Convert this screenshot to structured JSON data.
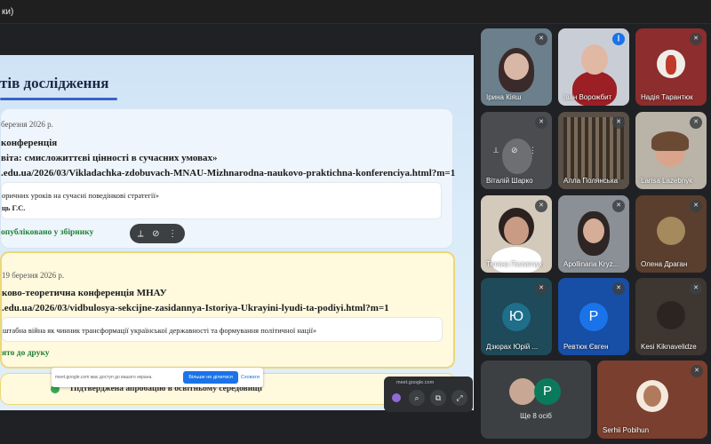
{
  "window": {
    "title": "ки)"
  },
  "screen": {
    "title": "тів дослідження",
    "cards": [
      {
        "date": "березня 2026 р.",
        "type": "конференція",
        "theme": "віта: смисложиттєві цінності в сучасних умовах»",
        "url": ".edu.ua/2026/03/Vikladachka-zdobuvach-MNAU-Mizhnarodna-naukovo-praktichna-konferenciya.html?m=1",
        "paper_title": "оричних уроків на сучасні поведінкові стратегії»",
        "authors": "ць Г.С.",
        "status": "опубліковано у збірнику"
      },
      {
        "date": "19 березня 2026 р.",
        "type": "ково-теоретична конференція МНАУ",
        "url": ".edu.ua/2026/03/vidbulosya-sekcijne-zasidannya-Istoriya-Ukrayini-lyudi-ta-podiyi.html?m=1",
        "paper_title": "штабна війна як чинник трансформації української державності та формування політичної нації»",
        "status": "ято до друку"
      },
      {
        "status": "Підтверджена апробацію в освітньому середовищі"
      }
    ]
  },
  "share_bar": {
    "message": "meet.google.com має доступ до вашого екрана.",
    "stop_label": "Більше не ділитися",
    "hide_label": "Сховати"
  },
  "pip": {
    "label": "meet.google.com"
  },
  "participants": [
    {
      "name": "Ірина Кіяш",
      "muted": true
    },
    {
      "name": "Іван Ворожбит",
      "muted": false
    },
    {
      "name": "Надія Тарантюк",
      "muted": true
    },
    {
      "name": "Віталій Шарко",
      "muted": true
    },
    {
      "name": "Алла Полянська",
      "muted": true
    },
    {
      "name": "Larisa Lazebnyk",
      "muted": true
    },
    {
      "name": "Тетяна Пилипчук",
      "muted": true
    },
    {
      "name": "Apollinaria Kryz...",
      "muted": true
    },
    {
      "name": "Олена Драган",
      "muted": true
    },
    {
      "name": "Дзюрах Юрій ...",
      "muted": true,
      "initial": "Ю",
      "color": "#1e6f8a"
    },
    {
      "name": "Ревтюк Євген",
      "muted": true,
      "initial": "Р",
      "color": "#1a73e8"
    },
    {
      "name": "Kesi Kiknavelidze",
      "muted": true
    },
    {
      "name": "Ще 8 осіб",
      "initial": "Р",
      "color": "#0b7a5c"
    },
    {
      "name": "Serhii Pobihun",
      "muted": true
    }
  ],
  "colors": {
    "background": "#202124",
    "accent": "#1a73e8",
    "status_green": "#1e7e34"
  }
}
